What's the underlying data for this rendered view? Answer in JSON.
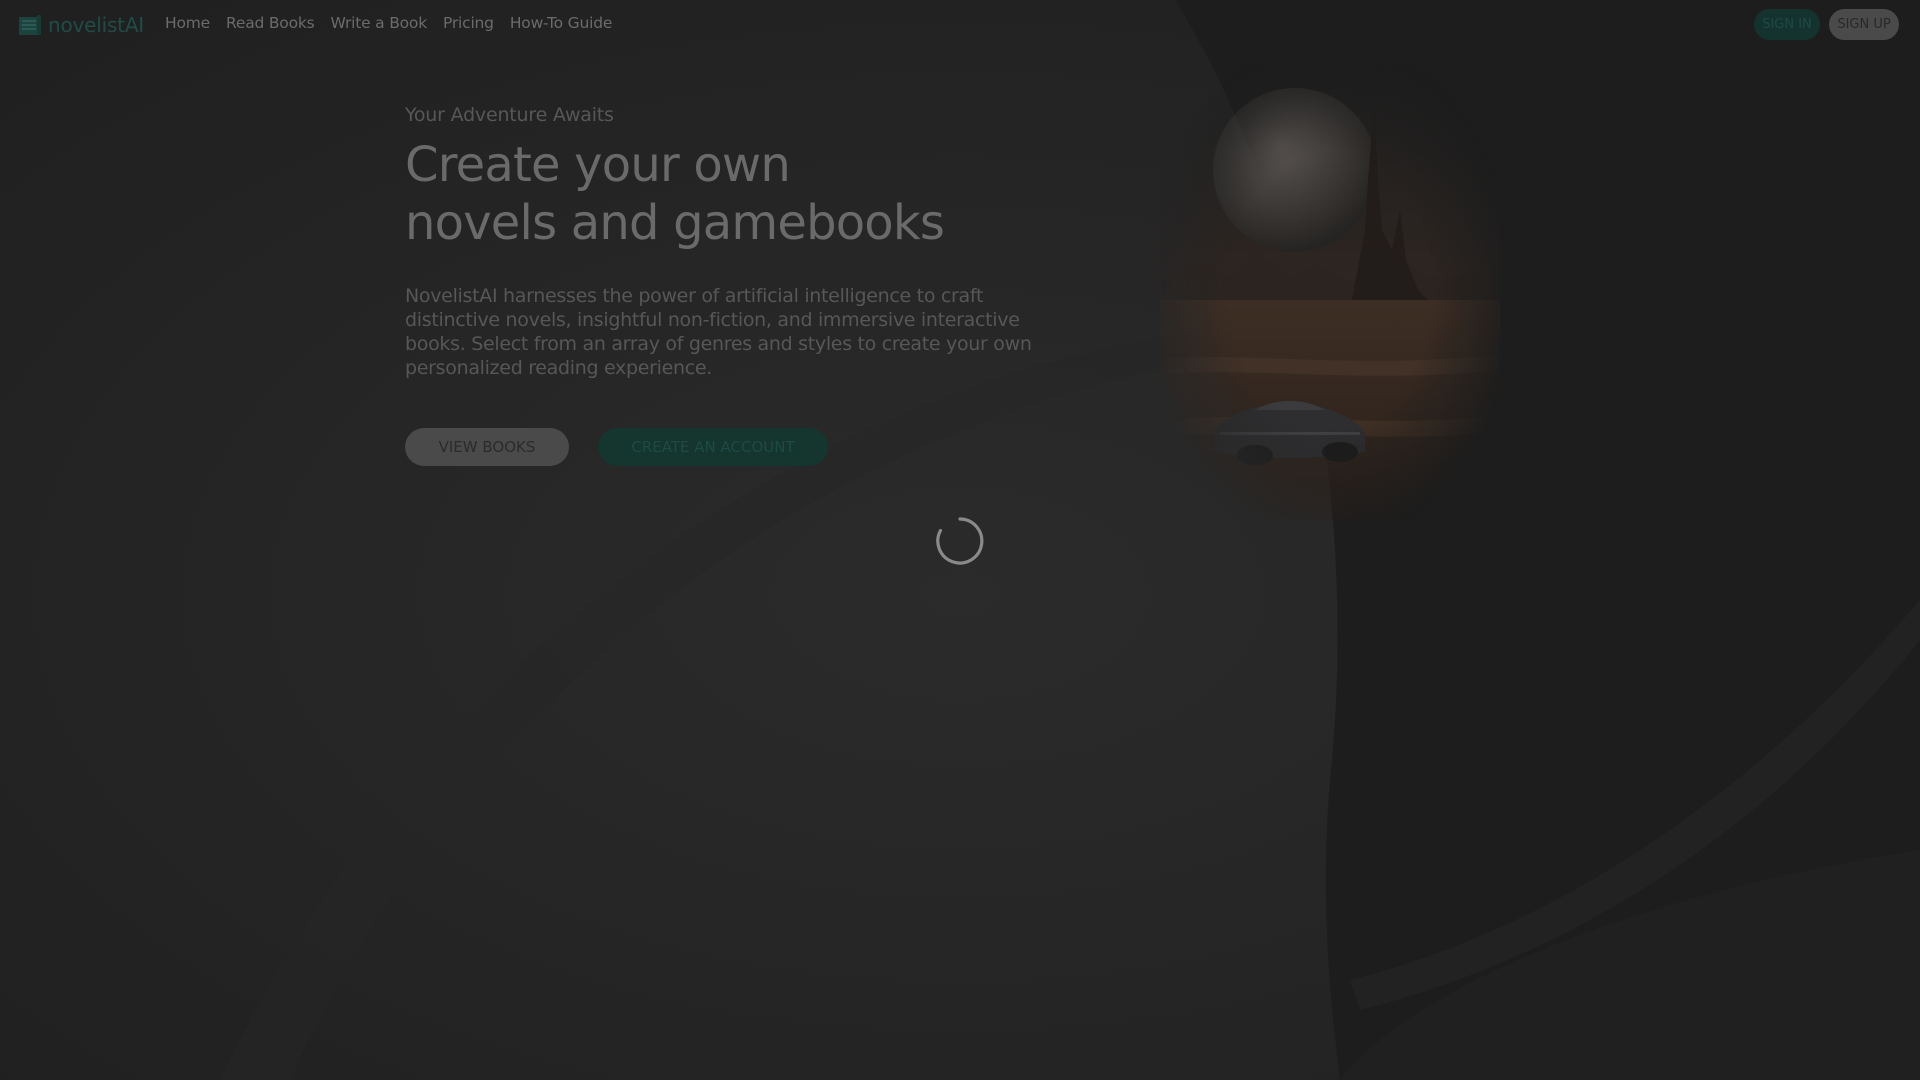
{
  "header": {
    "logo_text": "novelistAI",
    "nav": [
      {
        "label": "Home"
      },
      {
        "label": "Read Books"
      },
      {
        "label": "Write a Book"
      },
      {
        "label": "Pricing"
      },
      {
        "label": "How-To Guide"
      }
    ],
    "sign_in": "SIGN IN",
    "sign_up": "SIGN UP"
  },
  "hero": {
    "eyebrow": "Your Adventure Awaits",
    "headline_line1": "Create your own",
    "headline_line2": "novels and gamebooks",
    "description": "NovelistAI harnesses the power of artificial intelligence to craft distinctive novels, insightful non-fiction, and immersive interactive books. Select from an array of genres and styles to create your own personalized reading experience.",
    "view_books": "VIEW BOOKS",
    "create_account": "CREATE AN ACCOUNT"
  },
  "colors": {
    "background": "#232323",
    "accent": "#1f4c46",
    "overlay_note": "dimmed page under loading overlay"
  },
  "icons": {
    "logo": "book-stack-icon",
    "loader": "loading-spinner-icon"
  }
}
